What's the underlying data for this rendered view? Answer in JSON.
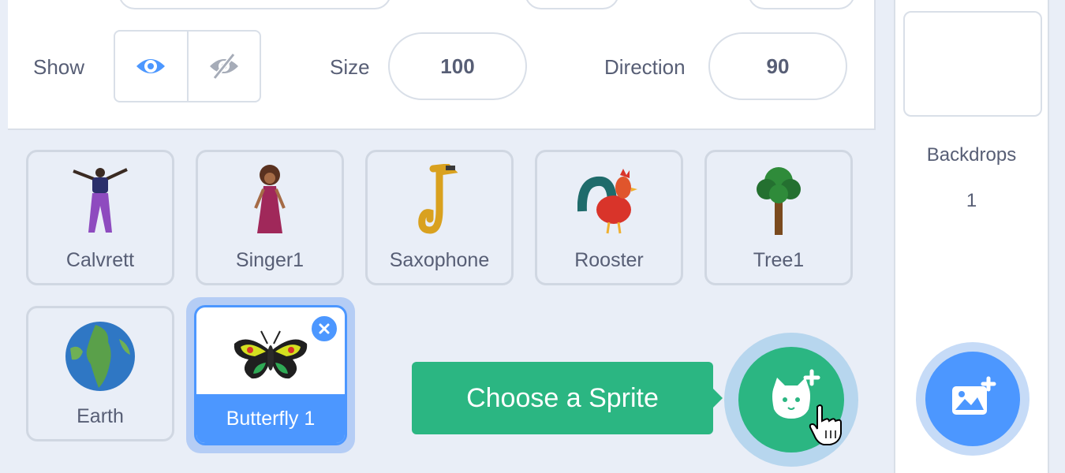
{
  "sprite_info": {
    "show_label": "Show",
    "size_label": "Size",
    "size_value": "100",
    "direction_label": "Direction",
    "direction_value": "90"
  },
  "sprites": [
    {
      "name": "Calvrett"
    },
    {
      "name": "Singer1"
    },
    {
      "name": "Saxophone"
    },
    {
      "name": "Rooster"
    },
    {
      "name": "Tree1"
    },
    {
      "name": "Earth"
    },
    {
      "name": "Butterfly 1",
      "selected": true
    }
  ],
  "choose_sprite": {
    "tooltip": "Choose a Sprite",
    "icon": "cat-plus-icon"
  },
  "stage": {
    "backdrops_label": "Backdrops",
    "backdrops_count": "1",
    "add_backdrop_icon": "image-plus-icon"
  },
  "colors": {
    "accent": "#4c97ff",
    "green": "#2bb682",
    "text": "#575e75",
    "panel_bg": "#e9eef7"
  }
}
